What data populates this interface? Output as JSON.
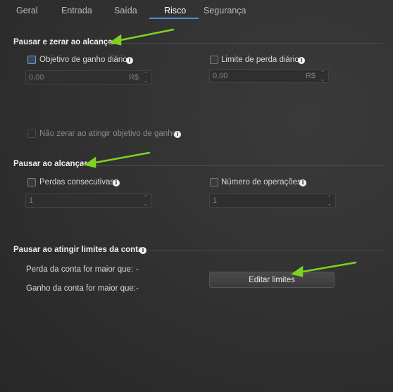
{
  "tabs": [
    {
      "label": "Geral"
    },
    {
      "label": "Entrada"
    },
    {
      "label": "Saída"
    },
    {
      "label": "Risco"
    },
    {
      "label": "Segurança"
    }
  ],
  "sections": {
    "pause_zero": {
      "title": "Pausar e zerar ao alcançar",
      "gain_label": "Objetivo de ganho diário",
      "gain_value": "0,00",
      "gain_unit": "R$",
      "loss_label": "Limite de perda diário",
      "loss_value": "0,00",
      "loss_unit": "R$",
      "no_zero_label": "Não zerar ao atingir objetivo de ganho"
    },
    "pause_reach": {
      "title": "Pausar ao alcançar",
      "consecutive_label": "Perdas consecutivas",
      "consecutive_value": "1",
      "ops_label": "Número de operações",
      "ops_value": "1"
    },
    "account_limits": {
      "title": "Pausar ao atingir limites da conta",
      "loss_label": "Perda da conta for maior que:",
      "loss_value": "-",
      "gain_label": "Ganho da conta for maior que:",
      "gain_value": "-",
      "edit_button": "Editar limites"
    }
  },
  "colors": {
    "accent": "#4d8fd6",
    "annotation_arrow": "#7ed321"
  }
}
